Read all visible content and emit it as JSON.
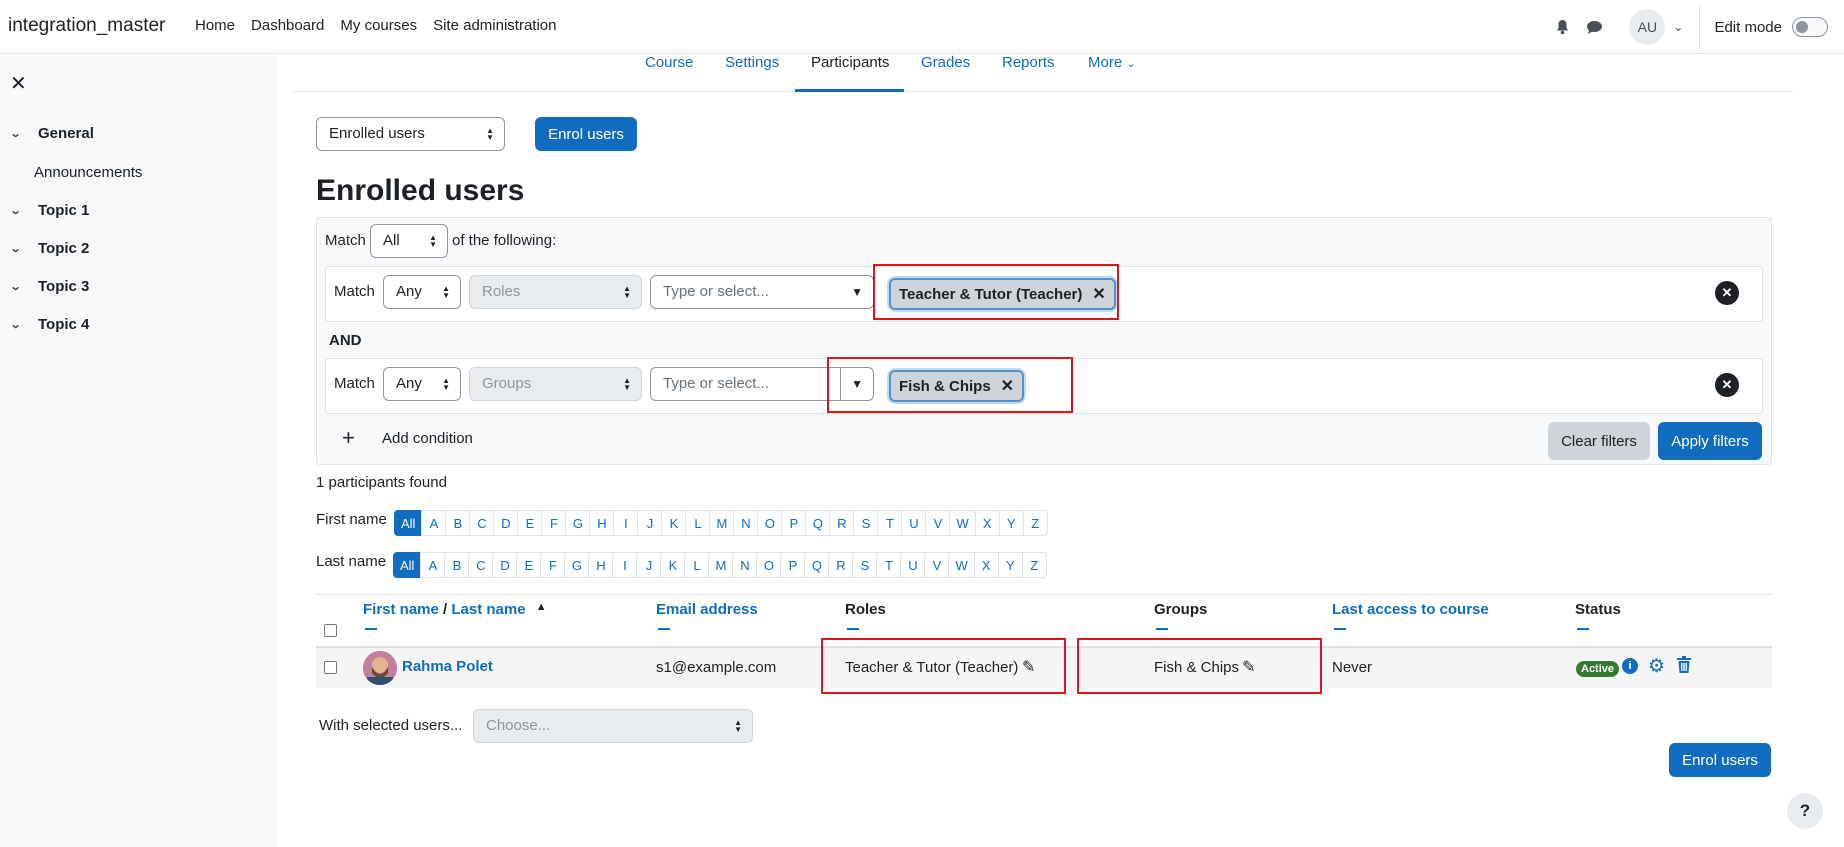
{
  "navbar": {
    "brand": "integration_master",
    "links": [
      "Home",
      "Dashboard",
      "My courses",
      "Site administration"
    ],
    "user_initials": "AU",
    "edit_mode_label": "Edit mode"
  },
  "drawer": {
    "close_icon": "close-icon",
    "sections": [
      {
        "label": "General"
      },
      {
        "label": "Announcements"
      },
      {
        "label": "Topic 1"
      },
      {
        "label": "Topic 2"
      },
      {
        "label": "Topic 3"
      },
      {
        "label": "Topic 4"
      }
    ]
  },
  "secondary_nav": {
    "tabs": [
      "Course",
      "Settings",
      "Participants",
      "Grades",
      "Reports",
      "More"
    ],
    "active": "Participants"
  },
  "top_controls": {
    "view_select": "Enrolled users",
    "enrol_button": "Enrol users"
  },
  "page_title": "Enrolled users",
  "filters": {
    "match_label": "Match",
    "match_value": "All",
    "of_following": "of the following:",
    "and_label": "AND",
    "rows": [
      {
        "match": "Match",
        "any": "Any",
        "type": "Roles",
        "placeholder": "Type or select...",
        "chip": "Teacher & Tutor (Teacher)"
      },
      {
        "match": "Match",
        "any": "Any",
        "type": "Groups",
        "placeholder": "Type or select...",
        "chip": "Fish & Chips"
      }
    ],
    "add_condition": "Add condition",
    "clear_filters": "Clear filters",
    "apply_filters": "Apply filters"
  },
  "results_count": "1 participants found",
  "initials_bar": {
    "first_name_label": "First name",
    "last_name_label": "Last name",
    "letters": [
      "All",
      "A",
      "B",
      "C",
      "D",
      "E",
      "F",
      "G",
      "H",
      "I",
      "J",
      "K",
      "L",
      "M",
      "N",
      "O",
      "P",
      "Q",
      "R",
      "S",
      "T",
      "U",
      "V",
      "W",
      "X",
      "Y",
      "Z"
    ]
  },
  "table": {
    "headers": {
      "first_name": "First name",
      "slash": "/",
      "last_name": "Last name",
      "email": "Email address",
      "roles": "Roles",
      "groups": "Groups",
      "last_access": "Last access to course",
      "status": "Status"
    },
    "rows": [
      {
        "name": "Rahma Polet",
        "email": "s1@example.com",
        "roles": "Teacher & Tutor (Teacher)",
        "groups": "Fish & Chips",
        "last_access": "Never",
        "status": "Active"
      }
    ]
  },
  "bulk": {
    "label": "With selected users...",
    "select_placeholder": "Choose..."
  },
  "bottom_enrol_button": "Enrol users",
  "help_button": "?",
  "colors": {
    "accent": "#0f6cbf",
    "highlight_box": "#e0141a",
    "status_active": "#357a32",
    "drawer_bg": "#f8f9fa"
  }
}
